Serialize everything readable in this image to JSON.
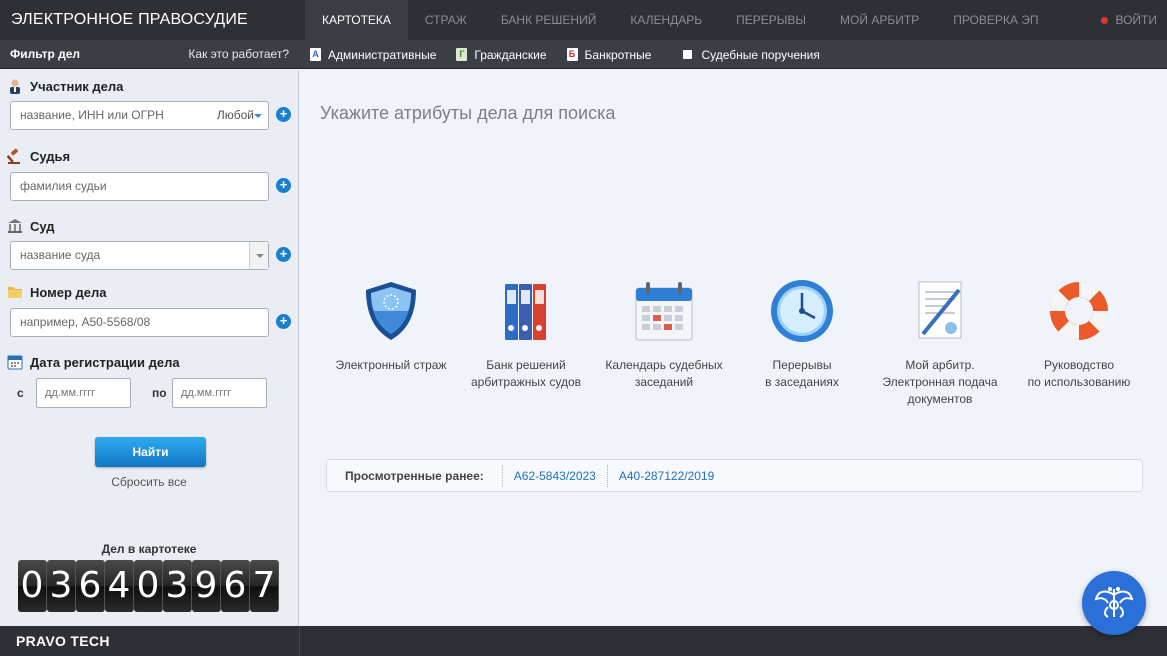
{
  "header": {
    "brand": "ЭЛЕКТРОННОЕ ПРАВОСУДИЕ",
    "nav": [
      "КАРТОТЕКА",
      "СТРАЖ",
      "БАНК РЕШЕНИЙ",
      "КАЛЕНДАРЬ",
      "ПЕРЕРЫВЫ",
      "МОЙ АРБИТР",
      "ПРОВЕРКА ЭП"
    ],
    "logout": "ВОЙТИ"
  },
  "subbar": {
    "filter_title": "Фильтр дел",
    "how_it_works": "Как это работает?",
    "categories": [
      {
        "badge": "А",
        "label": "Административные"
      },
      {
        "badge": "Г",
        "label": "Гражданские"
      },
      {
        "badge": "Б",
        "label": "Банкротные"
      },
      {
        "badge": "",
        "label": "Судебные поручения"
      }
    ]
  },
  "filter": {
    "participant_label": "Участник дела",
    "participant_placeholder": "название, ИНН или ОГРН",
    "participant_role": "Любой",
    "judge_label": "Судья",
    "judge_placeholder": "фамилия судьи",
    "court_label": "Суд",
    "court_placeholder": "название суда",
    "case_label": "Номер дела",
    "case_placeholder": "например, А50-5568/08",
    "date_label": "Дата регистрации дела",
    "date_from_prefix": "с",
    "date_to_prefix": "по",
    "date_placeholder": "дд.мм.гггг",
    "find": "Найти",
    "reset": "Сбросить все",
    "counter_label": "Дел в картотеке",
    "counter_digits": [
      "0",
      "3",
      "6",
      "4",
      "0",
      "3",
      "9",
      "6",
      "7"
    ]
  },
  "main": {
    "title": "Укажите атрибуты дела для поиска",
    "tiles": [
      {
        "icon": "shield-icon",
        "lines": [
          "Электронный страж"
        ]
      },
      {
        "icon": "binders-icon",
        "lines": [
          "Банк решений",
          "арбитражных судов"
        ]
      },
      {
        "icon": "calendar-icon",
        "lines": [
          "Календарь судебных",
          "заседаний"
        ]
      },
      {
        "icon": "clock-icon",
        "lines": [
          "Перерывы",
          "в заседаниях"
        ]
      },
      {
        "icon": "document-icon",
        "lines": [
          "Мой арбитр.",
          "Электронная подача",
          "документов"
        ]
      },
      {
        "icon": "lifebuoy-icon",
        "lines": [
          "Руководство",
          "по использованию"
        ]
      }
    ],
    "viewed_label": "Просмотренные ранее:",
    "viewed_links": [
      "А62-5843/2023",
      "А40-287122/2019"
    ]
  },
  "footer": {
    "brand": "PRAVO TECH"
  }
}
